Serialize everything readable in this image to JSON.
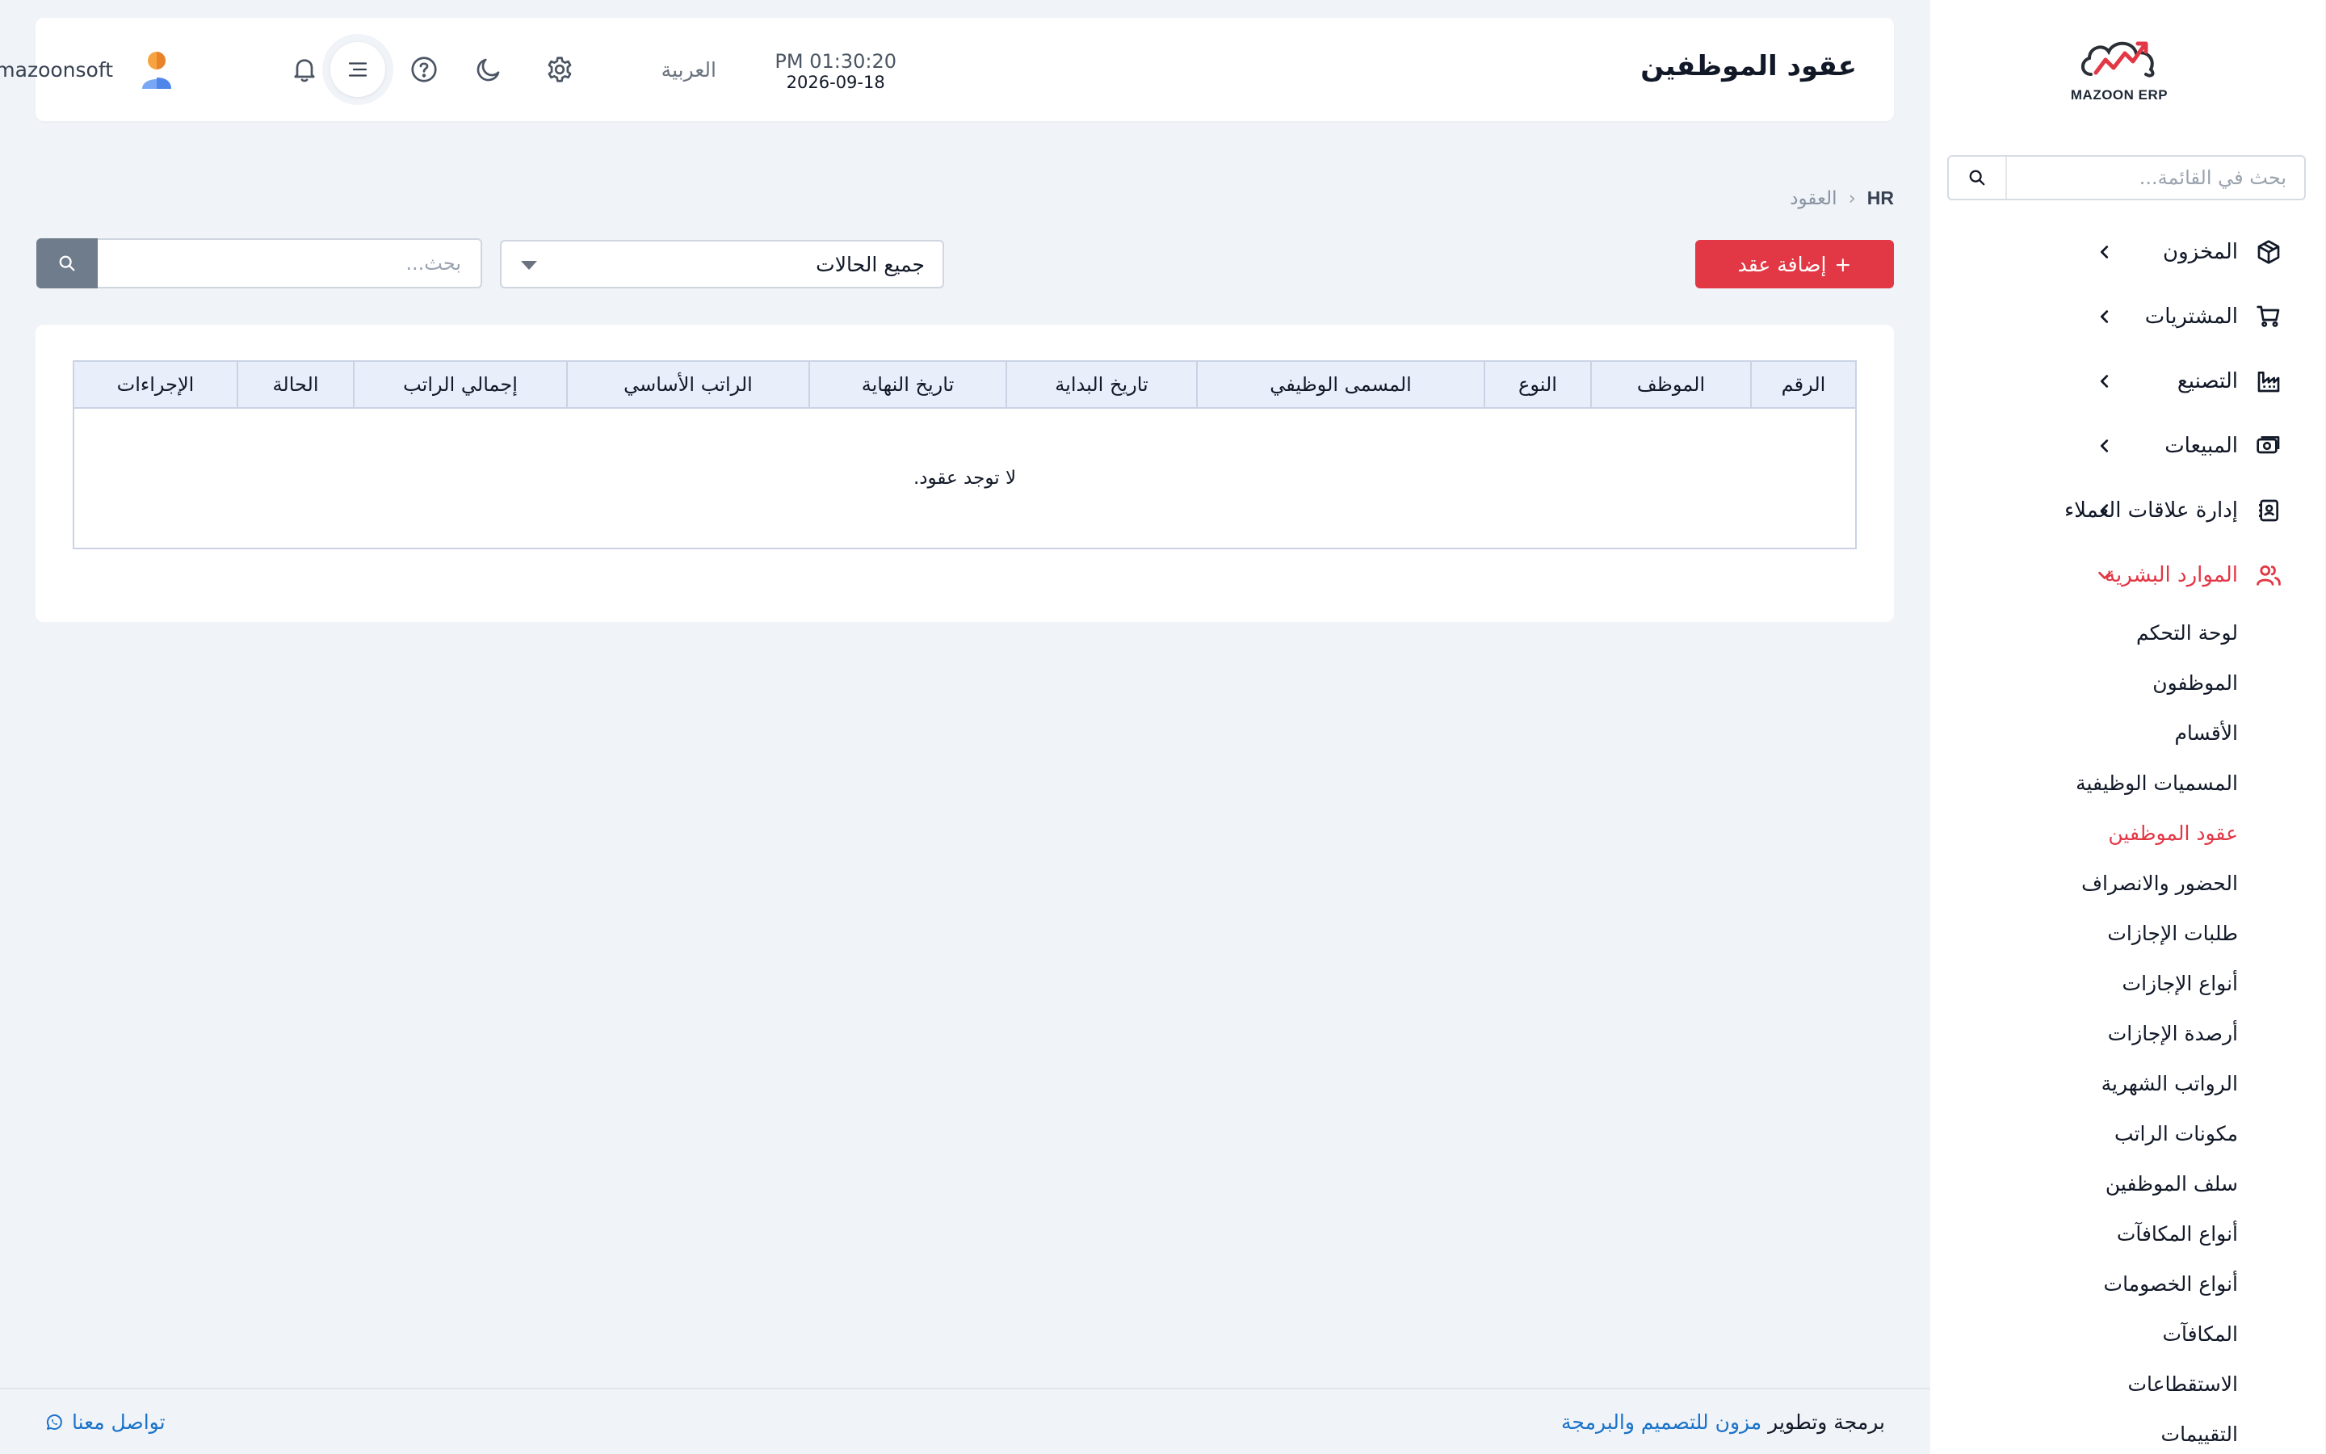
{
  "app": {
    "logo_text": "MAZOON ERP",
    "accent_color": "#e23744",
    "link_color": "#1a73c9"
  },
  "sidebar": {
    "search_placeholder": "بحث في القائمة...",
    "items": [
      {
        "label": "المخزون",
        "icon": "box-icon"
      },
      {
        "label": "المشتريات",
        "icon": "cart-icon"
      },
      {
        "label": "التصنيع",
        "icon": "factory-icon"
      },
      {
        "label": "المبيعات",
        "icon": "cash-icon"
      },
      {
        "label": "إدارة علاقات العملاء",
        "icon": "contacts-icon"
      },
      {
        "label": "الموارد البشرية",
        "icon": "users-icon",
        "expanded": true
      }
    ],
    "hr_sub_items": [
      "لوحة التحكم",
      "الموظفون",
      "الأقسام",
      "المسميات الوظيفية",
      "عقود الموظفين",
      "الحضور والانصراف",
      "طلبات الإجازات",
      "أنواع الإجازات",
      "أرصدة الإجازات",
      "الرواتب الشهرية",
      "مكونات الراتب",
      "سلف الموظفين",
      "أنواع المكافآت",
      "أنواع الخصومات",
      "المكافآت",
      "الاستقطاعات",
      "التقييمات"
    ],
    "active_sub_item": "عقود الموظفين"
  },
  "header": {
    "title": "عقود الموظفين",
    "time": "PM 01:30:20",
    "date": "2026-09-18",
    "language": "العربية",
    "username": "mazoonsoft"
  },
  "breadcrumb": {
    "root": "HR",
    "current": "العقود"
  },
  "toolbar": {
    "add_label": "إضافة عقد",
    "status_selected": "جميع الحالات",
    "search_placeholder": "بحث..."
  },
  "table": {
    "columns": [
      "الرقم",
      "الموظف",
      "النوع",
      "المسمى الوظيفي",
      "تاريخ البداية",
      "تاريخ النهاية",
      "الراتب الأساسي",
      "إجمالي الراتب",
      "الحالة",
      "الإجراءات"
    ],
    "empty_message": "لا توجد عقود."
  },
  "footer": {
    "credit_prefix": "برمجة وتطوير",
    "credit_link": "مزون للتصميم والبرمجة",
    "contact_label": "تواصل معنا"
  }
}
